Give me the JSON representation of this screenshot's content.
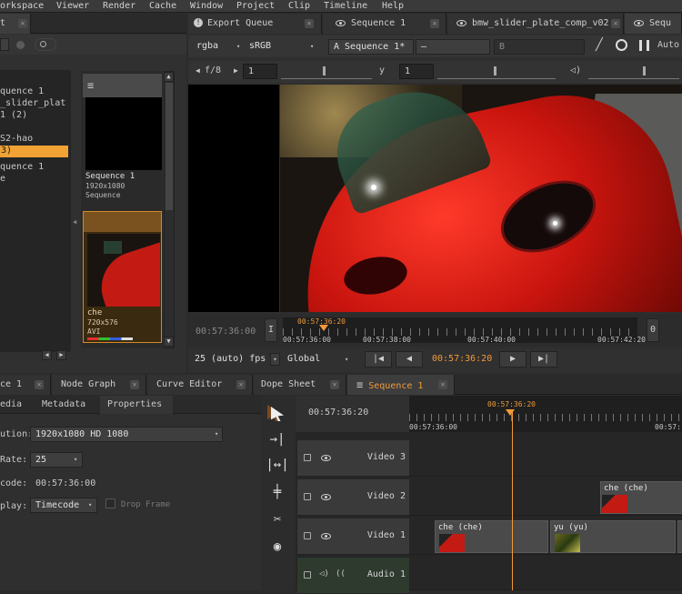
{
  "menubar": {
    "items": [
      "orkspace",
      "Viewer",
      "Render",
      "Cache",
      "Window",
      "Project",
      "Clip",
      "Timeline",
      "Help"
    ]
  },
  "left_panel": {
    "tab_label": "t",
    "tree": [
      "quence 1",
      "_slider_plat",
      "1 (2)",
      "S2-hao",
      "3)",
      "quence 1",
      "e"
    ],
    "thumbs": [
      {
        "name": "Sequence 1",
        "res": "1920x1080",
        "type": "Sequence"
      },
      {
        "name": "che",
        "res": "720x576",
        "type": "AVI"
      }
    ]
  },
  "viewer": {
    "tabs": [
      {
        "label": "Export Queue"
      },
      {
        "label": "Sequence 1"
      },
      {
        "label": "bmw_slider_plate_comp_v02"
      },
      {
        "label": "Sequ"
      }
    ],
    "toolbar": {
      "channels": "rgba",
      "colorspace": "sRGB",
      "input_a": "A  Sequence 1*",
      "input_a_arrow": "—",
      "input_b": "B",
      "auto": "Auto"
    },
    "toolbar2": {
      "fstop": "f/8",
      "gain": "1",
      "y_label": "y",
      "gamma": "1"
    },
    "timecode_left": "00:57:36:00",
    "timecode_marker": "00:57:36:20",
    "ruler": [
      "00:57:36:00",
      "00:57:38:00",
      "00:57:40:00",
      "00:57:42:20"
    ],
    "zero": "0",
    "fps": "25 (auto) fps",
    "scope": "Global",
    "playback_tc": "00:57:36:20"
  },
  "bottom_tabs": [
    {
      "label": "ce 1"
    },
    {
      "label": "Node Graph"
    },
    {
      "label": "Curve Editor"
    },
    {
      "label": "Dope Sheet"
    },
    {
      "label": "Sequence 1"
    }
  ],
  "properties": {
    "subtabs": [
      "edia",
      "Metadata",
      "Properties"
    ],
    "rows": [
      {
        "label": "ution:",
        "value": "1920x1080 HD 1080"
      },
      {
        "label": "Rate:",
        "value": "25"
      },
      {
        "label": "code:",
        "value": "00:57:36:00"
      },
      {
        "label": "play:",
        "value": "Timecode"
      }
    ],
    "drop_frame": "Drop Frame"
  },
  "timeline": {
    "current_tc": "00:57:36:20",
    "marker_tc": "00:57:36:20",
    "ruler": [
      "00:57:36:00",
      "00:57:"
    ],
    "tracks": [
      {
        "name": "Video 3",
        "clips": []
      },
      {
        "name": "Video 2",
        "clips": [
          {
            "label": "che (che)"
          }
        ]
      },
      {
        "name": "Video 1",
        "clips": [
          {
            "label": "che (che)"
          },
          {
            "label": "yu (yu)"
          }
        ]
      },
      {
        "name": "Audio 1",
        "clips": []
      }
    ]
  }
}
